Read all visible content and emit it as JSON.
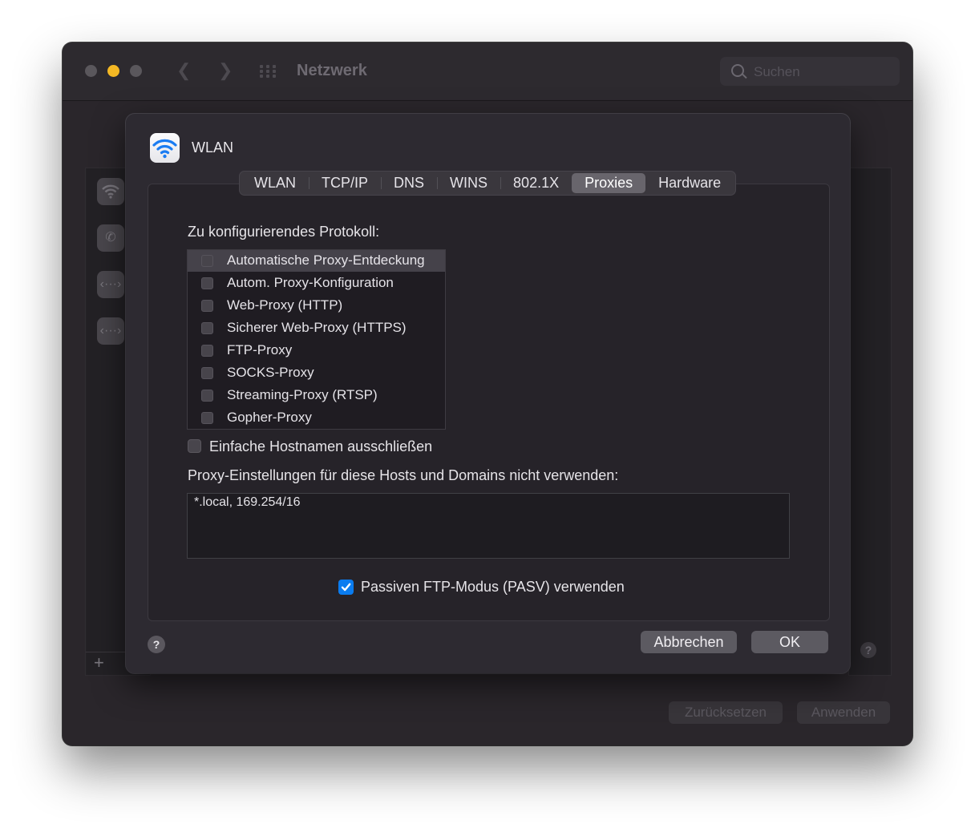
{
  "window": {
    "title": "Netzwerk",
    "search_placeholder": "Suchen",
    "traffic_lights": [
      "#5a575c",
      "#f4b824",
      "#5a575c"
    ]
  },
  "background": {
    "reset_label": "Zurücksetzen",
    "apply_label": "Anwenden",
    "help_label": "?",
    "add_label": "+"
  },
  "sheet": {
    "title": "WLAN",
    "tabs": [
      {
        "label": "WLAN"
      },
      {
        "label": "TCP/IP"
      },
      {
        "label": "DNS"
      },
      {
        "label": "WINS"
      },
      {
        "label": "802.1X"
      },
      {
        "label": "Proxies"
      },
      {
        "label": "Hardware"
      }
    ],
    "active_tab": "Proxies",
    "protocol_heading": "Zu konfigurierendes Protokoll:",
    "protocols": [
      {
        "label": "Automatische Proxy-Entdeckung",
        "checked": false,
        "selected": true
      },
      {
        "label": "Autom. Proxy-Konfiguration",
        "checked": false
      },
      {
        "label": "Web-Proxy (HTTP)",
        "checked": false
      },
      {
        "label": "Sicherer Web-Proxy (HTTPS)",
        "checked": false
      },
      {
        "label": "FTP-Proxy",
        "checked": false
      },
      {
        "label": "SOCKS-Proxy",
        "checked": false
      },
      {
        "label": "Streaming-Proxy (RTSP)",
        "checked": false
      },
      {
        "label": "Gopher-Proxy",
        "checked": false
      }
    ],
    "exclude_simple_hostnames_label": "Einfache Hostnamen ausschließen",
    "exclude_simple_hostnames_checked": false,
    "bypass_heading": "Proxy-Einstellungen für diese Hosts und Domains nicht verwenden:",
    "bypass_value": "*.local, 169.254/16",
    "pasv_label": "Passiven FTP-Modus (PASV) verwenden",
    "pasv_checked": true,
    "help_label": "?",
    "cancel_label": "Abbrechen",
    "ok_label": "OK",
    "accent_color": "#0a7cf0"
  }
}
